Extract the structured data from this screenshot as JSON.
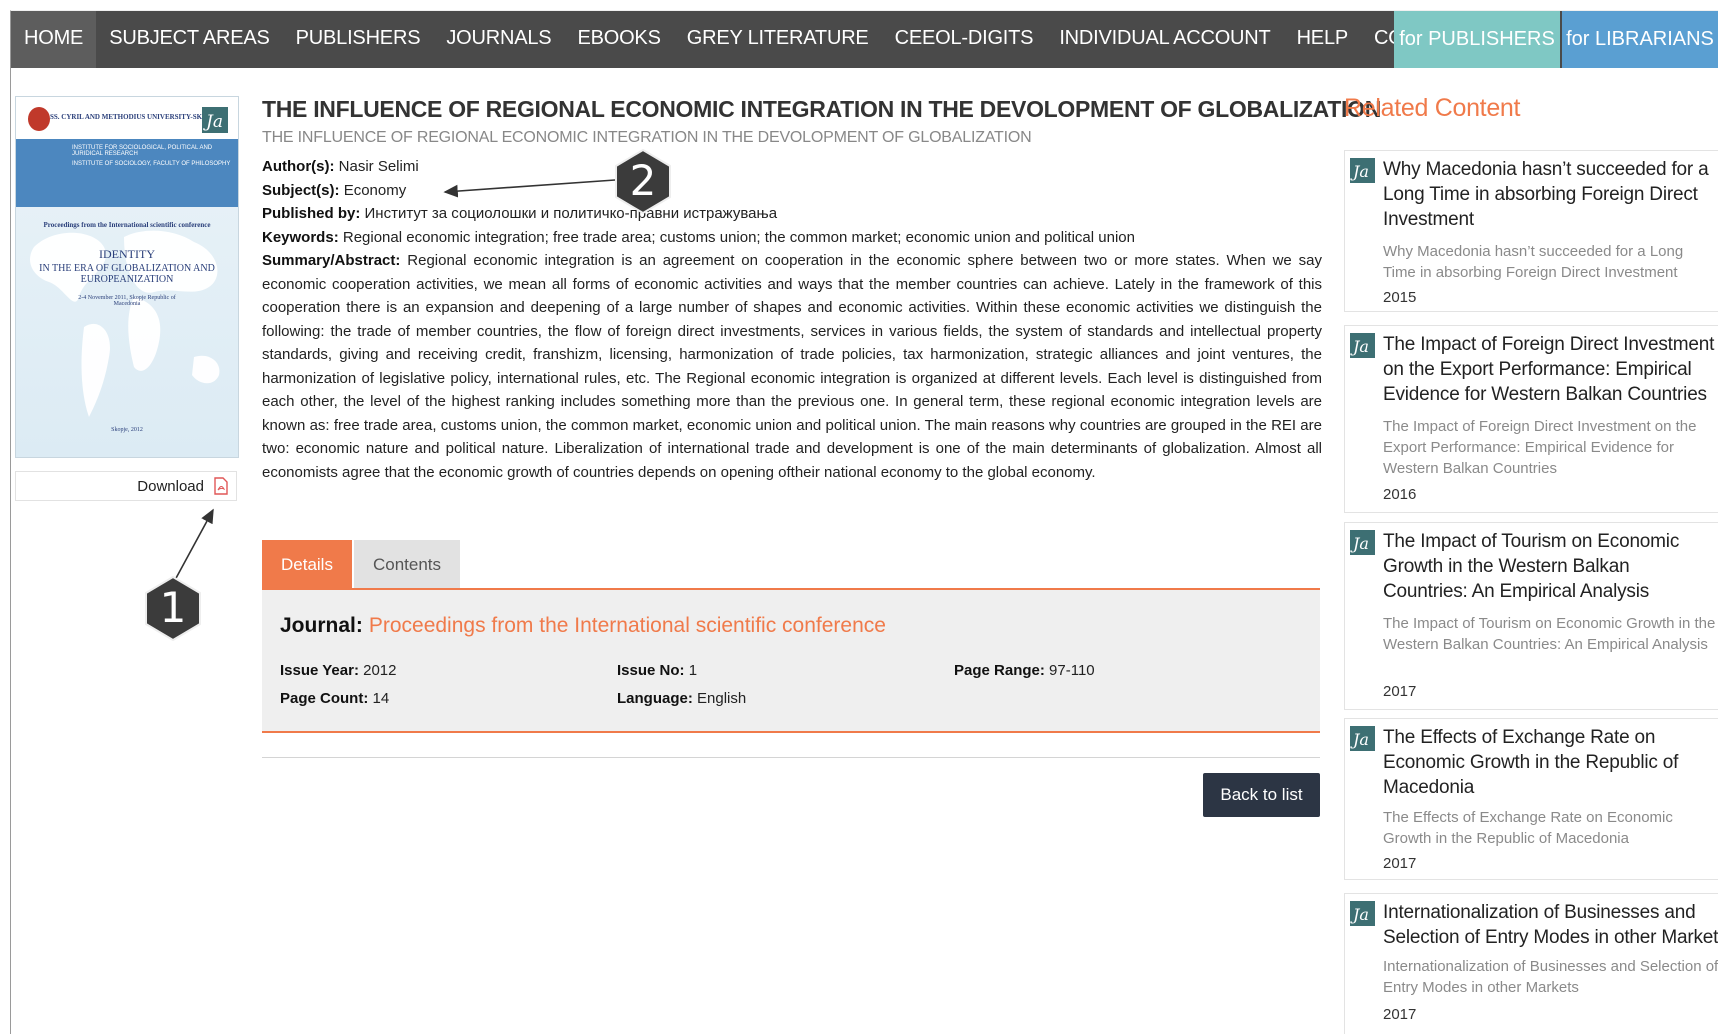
{
  "nav": {
    "items": [
      "HOME",
      "SUBJECT AREAS",
      "PUBLISHERS",
      "JOURNALS",
      "EBOOKS",
      "GREY LITERATURE",
      "CEEOL-DIGITS",
      "INDIVIDUAL ACCOUNT",
      "HELP",
      "CONTACT"
    ],
    "active": "HOME",
    "for_publishers": "for PUBLISHERS",
    "for_librarians": "for LIBRARIANS"
  },
  "cover": {
    "university": "SS. CYRIL AND METHODIUS UNIVERSITY-SKOPJE",
    "institute1": "INSTITUTE FOR SOCIOLOGICAL, POLITICAL AND JURIDICAL RESEARCH",
    "institute2": "INSTITUTE OF SOCIOLOGY, FACULTY OF PHILOSOPHY",
    "proceedings": "Proceedings from the International scientific conference",
    "identity": "IDENTITY",
    "era": "IN THE ERA OF GLOBALIZATION AND EUROPEANIZATION",
    "dates": "2-4 November 2011, Skopje Republic of Macedonia",
    "place_year": "Skopje, 2012"
  },
  "download": {
    "label": "Download",
    "icon": "pdf-icon"
  },
  "article": {
    "title": "THE INFLUENCE OF REGIONAL ECONOMIC INTEGRATION IN THE DEVOLOPMENT OF GLOBALIZATION",
    "subtitle": "THE INFLUENCE OF REGIONAL ECONOMIC INTEGRATION IN THE DEVOLOPMENT OF GLOBALIZATION",
    "authors_label": "Author(s):",
    "authors": "Nasir Selimi",
    "subjects_label": "Subject(s):",
    "subjects": "Economy",
    "published_label": "Published by:",
    "published": "Институт за социолошки и политичко-правни истражувања",
    "keywords_label": "Keywords:",
    "keywords": "Regional economic integration; free trade area; customs union; the common market; economic union and political union",
    "summary_label": "Summary/Abstract:",
    "summary": "Regional economic integration is an agreement on cooperation in the economic sphere between two or more states. When we say economic cooperation activities, we mean all forms of economic activities and ways that the member countries can achieve. Lately in the framework of this cooperation there is an expansion and deepening of a large number of shapes and economic activities. Within these economic activities we distinguish the following: the trade of member countries, the flow of foreign direct investments, services in various fields, the system of standards and intellectual property standards, giving and receiving credit, franshizm, licensing, harmonization of trade policies, tax harmonization, strategic alliances and joint ventures, the harmonization of legislative policy, international rules, etc.  The Regional economic integration is organized at different levels. Each level is distinguished from each other, the level of the highest ranking includes something more than the previous one. In general term, these regional economic integration levels are known as: free trade area, customs union, the common market, economic union and political union. The main reasons why countries are grouped in the REI are two: economic nature and political nature.  Liberalization of international trade and development is one of the main determinants of globalization. Almost all economists agree that the economic growth of countries depends on opening oftheir national economy to the global economy."
  },
  "tabs": {
    "details": "Details",
    "contents": "Contents"
  },
  "details": {
    "journal_label": "Journal:",
    "journal": "Proceedings from the International scientific conference",
    "issue_year_label": "Issue Year:",
    "issue_year": "2012",
    "issue_no_label": "Issue No:",
    "issue_no": "1",
    "page_range_label": "Page Range:",
    "page_range": "97-110",
    "page_count_label": "Page Count:",
    "page_count": "14",
    "language_label": "Language:",
    "language": "English"
  },
  "back_button": "Back to list",
  "related": {
    "heading": "Related Content",
    "items": [
      {
        "title": "Why Macedonia hasn’t succeeded for a Long Time in absorbing Foreign Direct Investment",
        "desc": "Why Macedonia hasn’t succeeded for a Long Time in absorbing Foreign Direct Investment",
        "year": "2015"
      },
      {
        "title": "The Impact of Foreign Direct Investment on the Export Performance: Empirical Evidence for Western Balkan Countries",
        "desc": "The Impact of Foreign Direct Investment on the Export Performance: Empirical Evidence for Western Balkan Countries",
        "year": "2016"
      },
      {
        "title": "The Impact of Tourism on Economic Growth in the Western Balkan Countries: An Empirical Analysis",
        "desc": "The Impact of Tourism on Economic Growth in the Western Balkan Countries: An Empirical Analysis",
        "year": "2017"
      },
      {
        "title": "The Effects of Exchange Rate on Economic Growth in the Republic of Macedonia",
        "desc": "The Effects of Exchange Rate on Economic Growth in the Republic of Macedonia",
        "year": "2017"
      },
      {
        "title": "Internationalization of Businesses and Selection of Entry Modes in other Markets",
        "desc": "Internationalization of Businesses and Selection of Entry Modes in other Markets",
        "year": "2017"
      }
    ]
  },
  "callouts": {
    "one": "1",
    "two": "2"
  },
  "colors": {
    "accent": "#f07a4a",
    "nav_bg": "#4a4a4a",
    "publishers": "#7fc8c4",
    "librarians": "#5a9fd2",
    "button_dark": "#2c3544"
  }
}
